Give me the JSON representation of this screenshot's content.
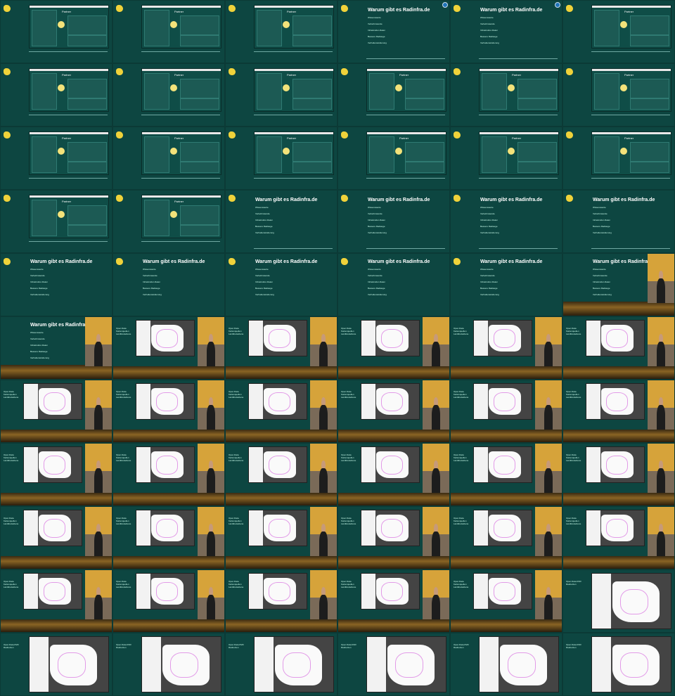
{
  "sheet": {
    "title": "Warum gibt es Radinfra.de",
    "partner_heading": "Partner",
    "flow_items": [
      "Wissenswerte",
      "Verkehrswende",
      "Infrastruktur-Daten",
      "Bessere Radwege",
      "Verhaltensänderung"
    ],
    "map_caption_a": "Open Data Kartenquellen Landkreisebene",
    "map_caption_b": "Open Data RVR Radnetzen",
    "colors": {
      "background": "#0b3a36",
      "cell": "#0d4641",
      "accent": "#f3e27a",
      "link": "#1f73b7"
    }
  },
  "cells": [
    {
      "kind": "partner"
    },
    {
      "kind": "partner"
    },
    {
      "kind": "partner"
    },
    {
      "kind": "title_top"
    },
    {
      "kind": "title_top"
    },
    {
      "kind": "partner"
    },
    {
      "kind": "partner"
    },
    {
      "kind": "partner"
    },
    {
      "kind": "partner"
    },
    {
      "kind": "partner"
    },
    {
      "kind": "partner"
    },
    {
      "kind": "partner"
    },
    {
      "kind": "partner"
    },
    {
      "kind": "partner"
    },
    {
      "kind": "partner"
    },
    {
      "kind": "partner"
    },
    {
      "kind": "partner"
    },
    {
      "kind": "partner"
    },
    {
      "kind": "partner"
    },
    {
      "kind": "partner"
    },
    {
      "kind": "title_bottom"
    },
    {
      "kind": "title_bottom"
    },
    {
      "kind": "title_bottom"
    },
    {
      "kind": "title_bottom"
    },
    {
      "kind": "title_full"
    },
    {
      "kind": "title_full"
    },
    {
      "kind": "title_full"
    },
    {
      "kind": "title_full"
    },
    {
      "kind": "title_full"
    },
    {
      "kind": "title_cam"
    },
    {
      "kind": "title_cam_left"
    },
    {
      "kind": "map_cam"
    },
    {
      "kind": "map_cam"
    },
    {
      "kind": "map_cam"
    },
    {
      "kind": "map_cam"
    },
    {
      "kind": "map_cam"
    },
    {
      "kind": "map_cam"
    },
    {
      "kind": "map_cam"
    },
    {
      "kind": "map_cam"
    },
    {
      "kind": "map_cam"
    },
    {
      "kind": "map_cam"
    },
    {
      "kind": "map_cam"
    },
    {
      "kind": "map_cam"
    },
    {
      "kind": "map_cam"
    },
    {
      "kind": "map_cam"
    },
    {
      "kind": "map_cam"
    },
    {
      "kind": "map_cam"
    },
    {
      "kind": "map_cam"
    },
    {
      "kind": "map_cam"
    },
    {
      "kind": "map_cam"
    },
    {
      "kind": "map_cam"
    },
    {
      "kind": "map_cam"
    },
    {
      "kind": "map_cam"
    },
    {
      "kind": "map_cam"
    },
    {
      "kind": "map_cam"
    },
    {
      "kind": "map_cam"
    },
    {
      "kind": "map_cam"
    },
    {
      "kind": "map_cam"
    },
    {
      "kind": "map_cam"
    },
    {
      "kind": "map_full"
    },
    {
      "kind": "map_full"
    },
    {
      "kind": "map_full"
    },
    {
      "kind": "map_full"
    },
    {
      "kind": "map_full"
    },
    {
      "kind": "map_full"
    },
    {
      "kind": "map_full"
    }
  ]
}
